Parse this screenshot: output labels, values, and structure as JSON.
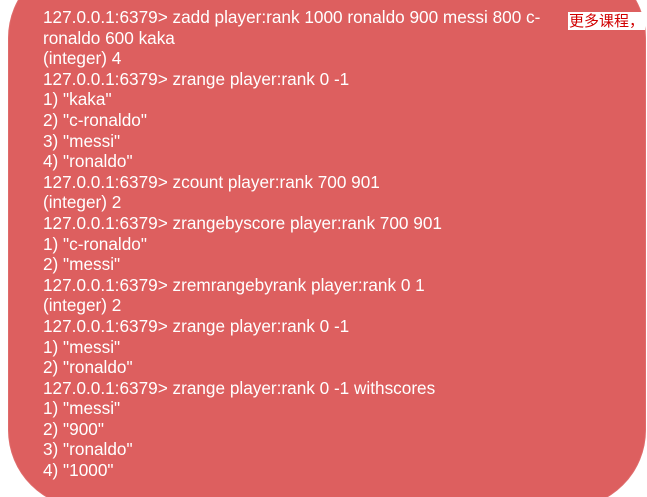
{
  "watermark": "更多课程，",
  "terminal": {
    "lines": [
      "127.0.0.1:6379> zadd player:rank 1000 ronaldo 900 messi 800 c-",
      "ronaldo 600 kaka",
      "(integer) 4",
      "127.0.0.1:6379> zrange player:rank 0 -1",
      "1) \"kaka\"",
      "2) \"c-ronaldo\"",
      "3) \"messi\"",
      "4) \"ronaldo\"",
      "127.0.0.1:6379> zcount player:rank 700 901",
      "(integer) 2",
      "127.0.0.1:6379> zrangebyscore player:rank 700 901",
      "1) \"c-ronaldo\"",
      "2) \"messi\"",
      "127.0.0.1:6379> zremrangebyrank player:rank 0 1",
      "(integer) 2",
      "127.0.0.1:6379> zrange player:rank 0 -1",
      "1) \"messi\"",
      "2) \"ronaldo\"",
      "127.0.0.1:6379> zrange player:rank 0 -1 withscores",
      "1) \"messi\"",
      "2) \"900\"",
      "3) \"ronaldo\"",
      "4) \"1000\""
    ]
  },
  "colors": {
    "panel": "#dd5f5f",
    "text": "#ffffff",
    "watermark": "#d10000"
  }
}
